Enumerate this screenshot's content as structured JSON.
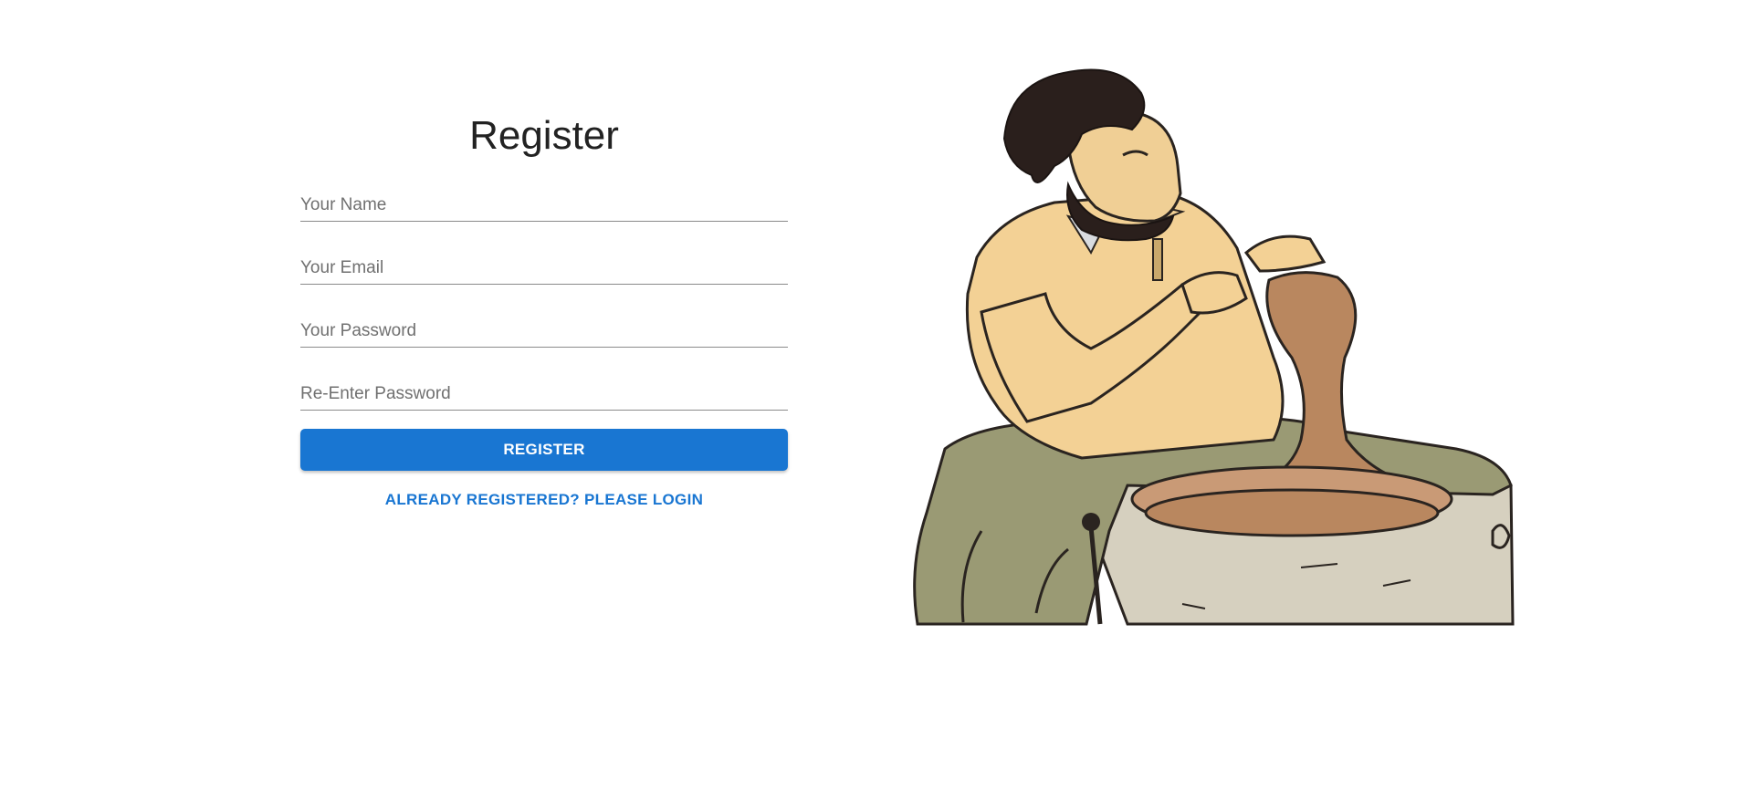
{
  "form": {
    "title": "Register",
    "name_placeholder": "Your Name",
    "email_placeholder": "Your Email",
    "password_placeholder": "Your Password",
    "reenter_placeholder": "Re-Enter Password",
    "register_label": "REGISTER",
    "login_link_label": "ALREADY REGISTERED? PLEASE LOGIN"
  },
  "colors": {
    "accent": "#1976d2",
    "title_text": "#222222",
    "placeholder": "#707070",
    "underline": "#8a8a8a"
  },
  "illustration": {
    "subject": "potter-at-wheel-illustration"
  }
}
